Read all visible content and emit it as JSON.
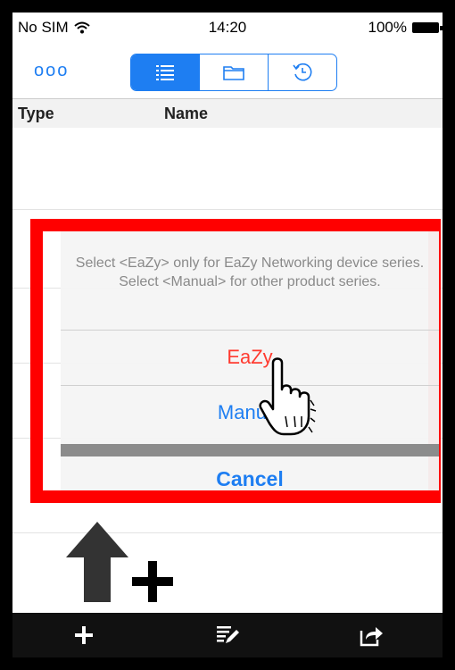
{
  "status_bar": {
    "carrier": "No SIM",
    "time": "14:20",
    "battery": "100%",
    "icons": [
      "wifi-icon",
      "battery-icon"
    ]
  },
  "nav": {
    "more_label": "ooo",
    "segments": [
      {
        "name": "list",
        "icon": "list-icon",
        "selected": true
      },
      {
        "name": "folder",
        "icon": "folder-icon",
        "selected": false
      },
      {
        "name": "history",
        "icon": "clock-history-icon",
        "selected": false
      }
    ]
  },
  "table": {
    "columns": [
      "Type",
      "Name"
    ]
  },
  "dialog": {
    "message": "Select <EaZy> only for EaZy Networking device series. Select <Manual> for other product series.",
    "options": [
      "EaZy",
      "Manual"
    ],
    "cancel": "Cancel"
  },
  "bottom_bar": {
    "buttons": [
      {
        "name": "add",
        "icon": "plus-icon"
      },
      {
        "name": "edit",
        "icon": "edit-list-icon"
      },
      {
        "name": "export",
        "icon": "share-icon"
      }
    ]
  },
  "colors": {
    "accent": "#1e7ef2",
    "destructive": "#ff3b30",
    "highlight_box": "#ff0000"
  }
}
